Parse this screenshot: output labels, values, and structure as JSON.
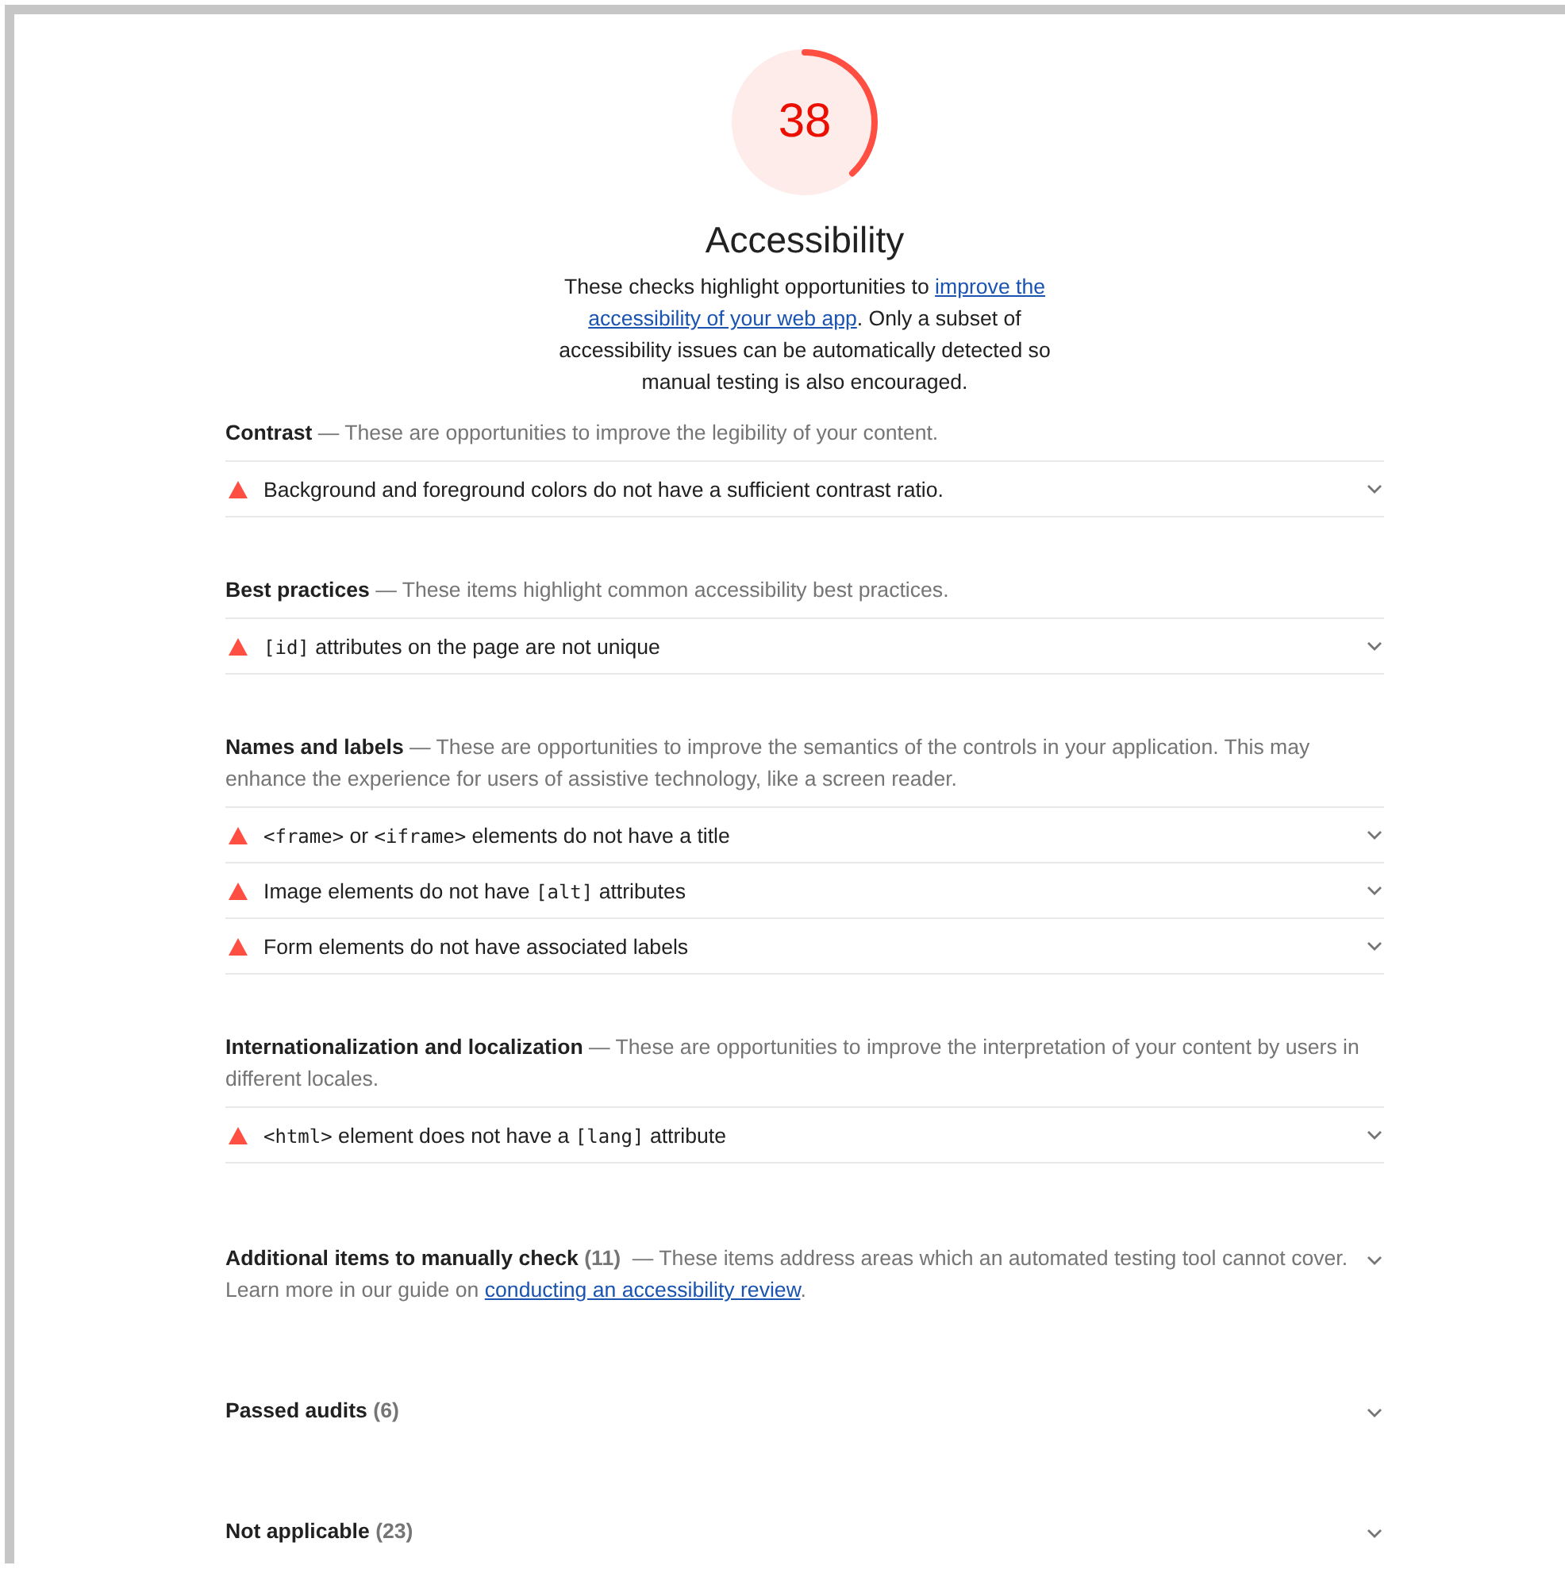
{
  "gauge": {
    "score": "38",
    "level": 0.38
  },
  "title": "Accessibility",
  "description": {
    "before": "These checks highlight opportunities to ",
    "link": [
      "improve the",
      "accessibility of your web app"
    ],
    "after": ". Only a subset of accessibility issues can be automatically detected so manual testing is also encouraged."
  },
  "groups": [
    {
      "title": "Contrast",
      "description": "— These are opportunities to improve the legibility of your content.",
      "audits": [
        {
          "parts": [
            {
              "kind": "text",
              "text": "Background and foreground colors do not have a sufficient contrast ratio."
            }
          ]
        }
      ]
    },
    {
      "title": "Best practices",
      "description": "— These items highlight common accessibility best practices.",
      "audits": [
        {
          "parts": [
            {
              "kind": "code",
              "text": "[id]"
            },
            {
              "kind": "text",
              "text": " attributes on the page are not unique"
            }
          ]
        }
      ]
    },
    {
      "title": "Names and labels",
      "description": "— These are opportunities to improve the semantics of the controls in your application. This may enhance the experience for users of assistive technology, like a screen reader.",
      "audits": [
        {
          "parts": [
            {
              "kind": "code",
              "text": "<frame>"
            },
            {
              "kind": "text",
              "text": " or "
            },
            {
              "kind": "code",
              "text": "<iframe>"
            },
            {
              "kind": "text",
              "text": " elements do not have a title"
            }
          ]
        },
        {
          "parts": [
            {
              "kind": "text",
              "text": "Image elements do not have "
            },
            {
              "kind": "code",
              "text": "[alt]"
            },
            {
              "kind": "text",
              "text": " attributes"
            }
          ]
        },
        {
          "parts": [
            {
              "kind": "text",
              "text": "Form elements do not have associated labels"
            }
          ]
        }
      ]
    },
    {
      "title": "Internationalization and localization",
      "description": "— These are opportunities to improve the interpretation of your content by users in different locales.",
      "audits": [
        {
          "parts": [
            {
              "kind": "code",
              "text": "<html>"
            },
            {
              "kind": "text",
              "text": " element does not have a "
            },
            {
              "kind": "code",
              "text": "[lang]"
            },
            {
              "kind": "text",
              "text": " attribute"
            }
          ]
        }
      ]
    }
  ],
  "collapsed_groups": [
    {
      "title": "Additional items to manually check",
      "count": "(11)",
      "description": "— These items address areas which an automated testing tool cannot cover.",
      "note": {
        "before": "Learn more in our guide on ",
        "link": "conducting an accessibility review",
        "after": "."
      }
    },
    {
      "title": "Passed audits",
      "count": "(6)"
    },
    {
      "title": "Not applicable",
      "count": "(23)"
    }
  ]
}
